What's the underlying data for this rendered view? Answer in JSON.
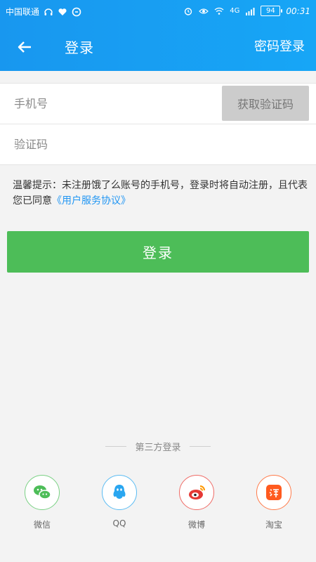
{
  "status_bar": {
    "carrier": "中国联通",
    "time": "00:31",
    "battery": "94",
    "network": "4G"
  },
  "navbar": {
    "title": "登录",
    "right_link": "密码登录"
  },
  "form": {
    "phone_placeholder": "手机号",
    "code_placeholder": "验证码",
    "get_code_label": "获取验证码"
  },
  "tip": {
    "text": "温馨提示：未注册饿了么账号的手机号，登录时将自动注册，且代表您已同意",
    "link": "《用户服务协议》"
  },
  "login_button": "登录",
  "third_party": {
    "title": "第三方登录",
    "items": [
      {
        "label": "微信",
        "icon": "wechat-icon",
        "color": "#4dbd58"
      },
      {
        "label": "QQ",
        "icon": "qq-icon",
        "color": "#2aa6f0"
      },
      {
        "label": "微博",
        "icon": "weibo-icon",
        "color": "#e53935"
      },
      {
        "label": "淘宝",
        "icon": "taobao-icon",
        "color": "#ff5a1f"
      }
    ]
  }
}
